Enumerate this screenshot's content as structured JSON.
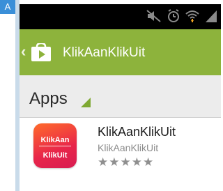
{
  "annotation": {
    "badge_label": "A"
  },
  "status_bar": {
    "icons": [
      "mute-icon",
      "alarm-icon",
      "wifi-icon",
      "signal-icon"
    ],
    "background_color": "#000000"
  },
  "action_bar": {
    "title": "KlikAanKlikUit",
    "back_glyph": "‹",
    "background_color": "#8db33c"
  },
  "section": {
    "title": "Apps"
  },
  "app_list": {
    "items": [
      {
        "icon_text_top": "KlikAan",
        "icon_text_bottom": "KlikUit",
        "name": "KlikAanKlikUit",
        "developer": "KlikAanKlikUit",
        "rating_stars": "★★★★★"
      }
    ]
  }
}
